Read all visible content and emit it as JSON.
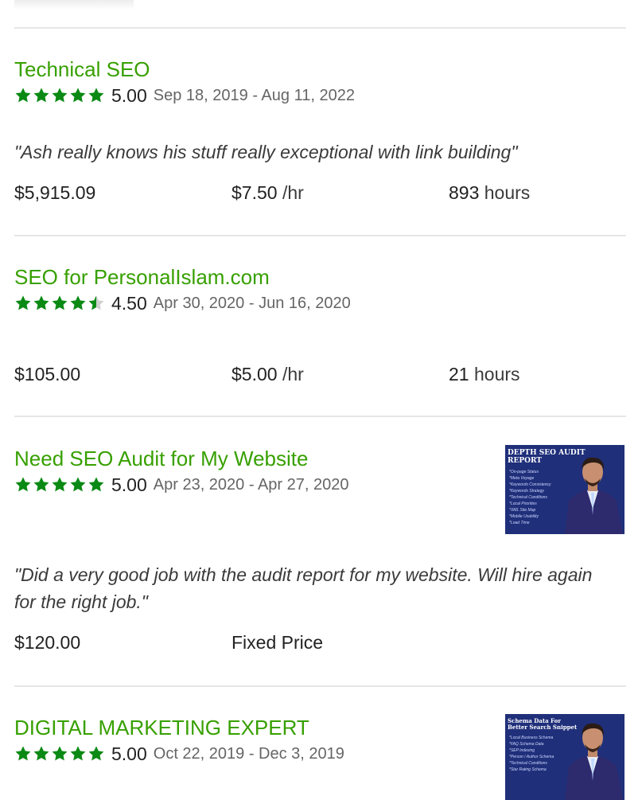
{
  "accent_color": "#37a000",
  "star_color": "#0a8a14",
  "jobs": [
    {
      "title": "Technical SEO",
      "score": "5.00",
      "dates": "Sep 18, 2019 - Aug 11, 2022",
      "rating": 5,
      "feedback": "\"Ash really knows his stuff really exceptional with link building\"",
      "earned": "$5,915.09",
      "rate": "$7.50",
      "rate_unit": "/hr",
      "hours": "893",
      "hours_unit": "hours"
    },
    {
      "title": "SEO for PersonalIslam.com",
      "score": "4.50",
      "dates": "Apr 30, 2020 - Jun 16, 2020",
      "rating": 4.5,
      "earned": "$105.00",
      "rate": "$5.00",
      "rate_unit": "/hr",
      "hours": "21",
      "hours_unit": "hours"
    },
    {
      "title": "Need SEO Audit for My Website",
      "score": "5.00",
      "dates": "Apr 23, 2020 - Apr 27, 2020",
      "rating": 5,
      "feedback": "\"Did a very good job with the audit report for my website. Will hire again for the right job.\"",
      "earned": "$120.00",
      "price_type": "Fixed Price",
      "thumbnail": {
        "heading": "DEPTH SEO AUDIT REPORT",
        "items": [
          "*On-page Status",
          "*Meta Voyage",
          "*Keywords Consistency",
          "*Keywords Strategy",
          "*Technical Conditions",
          "*Local Priorities",
          "*XML Site Map",
          "*Mobile Usability",
          "*Load Time"
        ]
      }
    },
    {
      "title": "DIGITAL MARKETING EXPERT",
      "score": "5.00",
      "dates": "Oct 22, 2019 - Dec 3, 2019",
      "rating": 5,
      "thumbnail": {
        "heading": "Schema Data For Better Search Snippet",
        "items": [
          "*Local Business Schema",
          "*FAQ Schema Data",
          "*SEP Indexing",
          "*Person / Author Schema",
          "*Technical Conditions",
          "*Star Rating Schema"
        ]
      }
    }
  ]
}
